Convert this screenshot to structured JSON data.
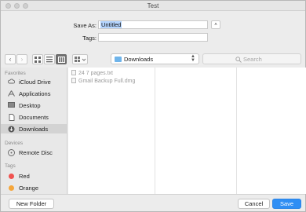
{
  "window": {
    "title": "Test"
  },
  "save_as": {
    "label": "Save As:",
    "value": "Untitled"
  },
  "tags": {
    "label": "Tags:",
    "value": ""
  },
  "expand_glyph": "˄",
  "toolbar": {
    "back_glyph": "‹",
    "forward_glyph": "›",
    "location": "Downloads",
    "search_placeholder": "Search"
  },
  "sidebar": {
    "favorites_label": "Favorites",
    "favorites": [
      {
        "label": "iCloud Drive",
        "icon": "cloud-icon"
      },
      {
        "label": "Applications",
        "icon": "applications-icon"
      },
      {
        "label": "Desktop",
        "icon": "desktop-icon"
      },
      {
        "label": "Documents",
        "icon": "documents-icon"
      },
      {
        "label": "Downloads",
        "icon": "downloads-icon",
        "selected": true
      }
    ],
    "devices_label": "Devices",
    "devices": [
      {
        "label": "Remote Disc",
        "icon": "disc-icon"
      }
    ],
    "tags_label": "Tags",
    "tags": [
      {
        "label": "Red",
        "color": "#f0524f"
      },
      {
        "label": "Orange",
        "color": "#f5a63a"
      }
    ]
  },
  "files": [
    {
      "name": "24 7 pages.txt",
      "icon": "text-file-icon"
    },
    {
      "name": "Gmail Backup Full.dmg",
      "icon": "dmg-file-icon"
    }
  ],
  "buttons": {
    "new_folder": "New Folder",
    "cancel": "Cancel",
    "save": "Save"
  },
  "colors": {
    "accent": "#2f8ef4",
    "selection": "#b5d5ff"
  }
}
